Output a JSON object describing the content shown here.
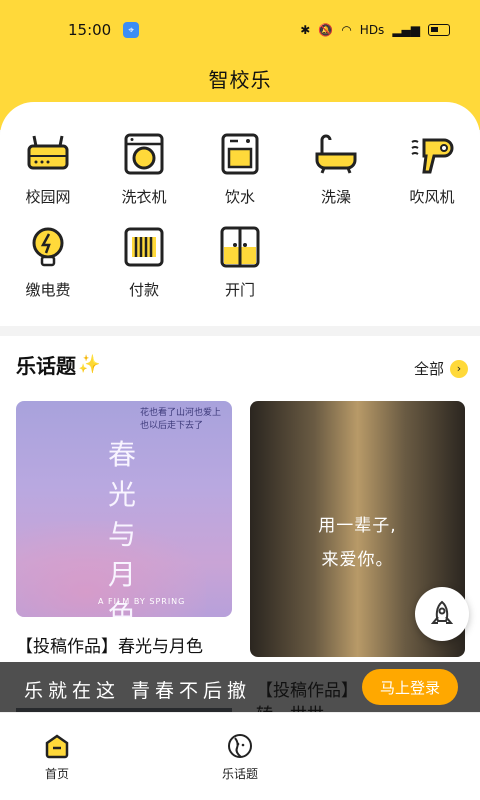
{
  "status": {
    "time": "15:00",
    "network": "HDs"
  },
  "app": {
    "title": "智校乐"
  },
  "services": [
    {
      "label": "校园网",
      "icon": "router-icon"
    },
    {
      "label": "洗衣机",
      "icon": "washing-machine-icon"
    },
    {
      "label": "饮水",
      "icon": "water-dispenser-icon"
    },
    {
      "label": "洗澡",
      "icon": "bathtub-icon"
    },
    {
      "label": "吹风机",
      "icon": "hair-dryer-icon"
    },
    {
      "label": "缴电费",
      "icon": "lightbulb-icon"
    },
    {
      "label": "付款",
      "icon": "payment-icon"
    },
    {
      "label": "开门",
      "icon": "door-icon"
    }
  ],
  "topics": {
    "title": "乐话题",
    "all_label": "全部",
    "cards": [
      {
        "title": "【投稿作品】春光与月色",
        "art_text": "春光与月色",
        "art_small": "花也看了山河也爱上 也以后走下去了",
        "art_film": "A FILM BY SPRING"
      },
      {
        "title": "【投稿作品】",
        "title_line2": "转，世世",
        "art_line1": "用一辈子,",
        "art_line2": "来爱你。"
      }
    ]
  },
  "promo": {
    "slogan": "乐就在这 青春不后撤",
    "login_label": "马上登录"
  },
  "nav": [
    {
      "label": "首页",
      "icon": "home-icon"
    },
    {
      "label": "乐话题",
      "icon": "topic-icon"
    }
  ],
  "colors": {
    "accent": "#ffd93a",
    "login": "#ffa800"
  }
}
